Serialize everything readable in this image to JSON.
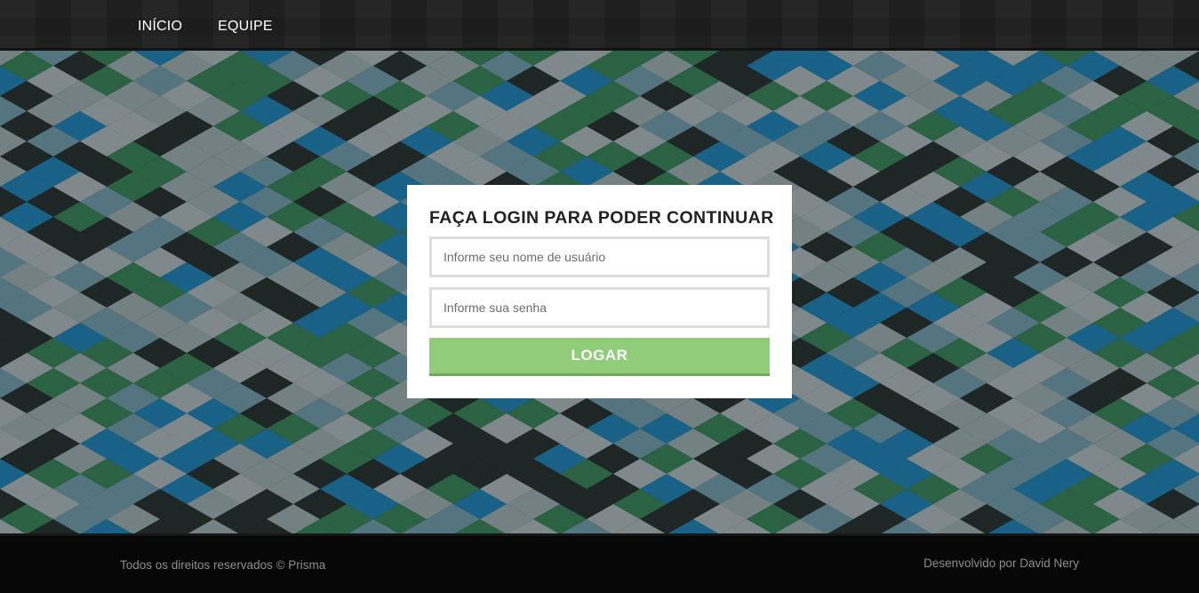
{
  "nav": {
    "items": [
      {
        "label": "INÍCIO"
      },
      {
        "label": "EQUIPE"
      }
    ]
  },
  "login": {
    "title": "FAÇA LOGIN PARA PODER CONTINUAR",
    "username_placeholder": "Informe seu nome de usuário",
    "password_placeholder": "Informe sua senha",
    "submit_label": "LOGAR"
  },
  "footer": {
    "copyright": "Todos os direitos reservados © Prisma",
    "credit": "Desenvolvido por David Nery"
  },
  "colors": {
    "button": "#91cc7b",
    "topbar": "#1f1f1f",
    "footer": "#060606"
  }
}
